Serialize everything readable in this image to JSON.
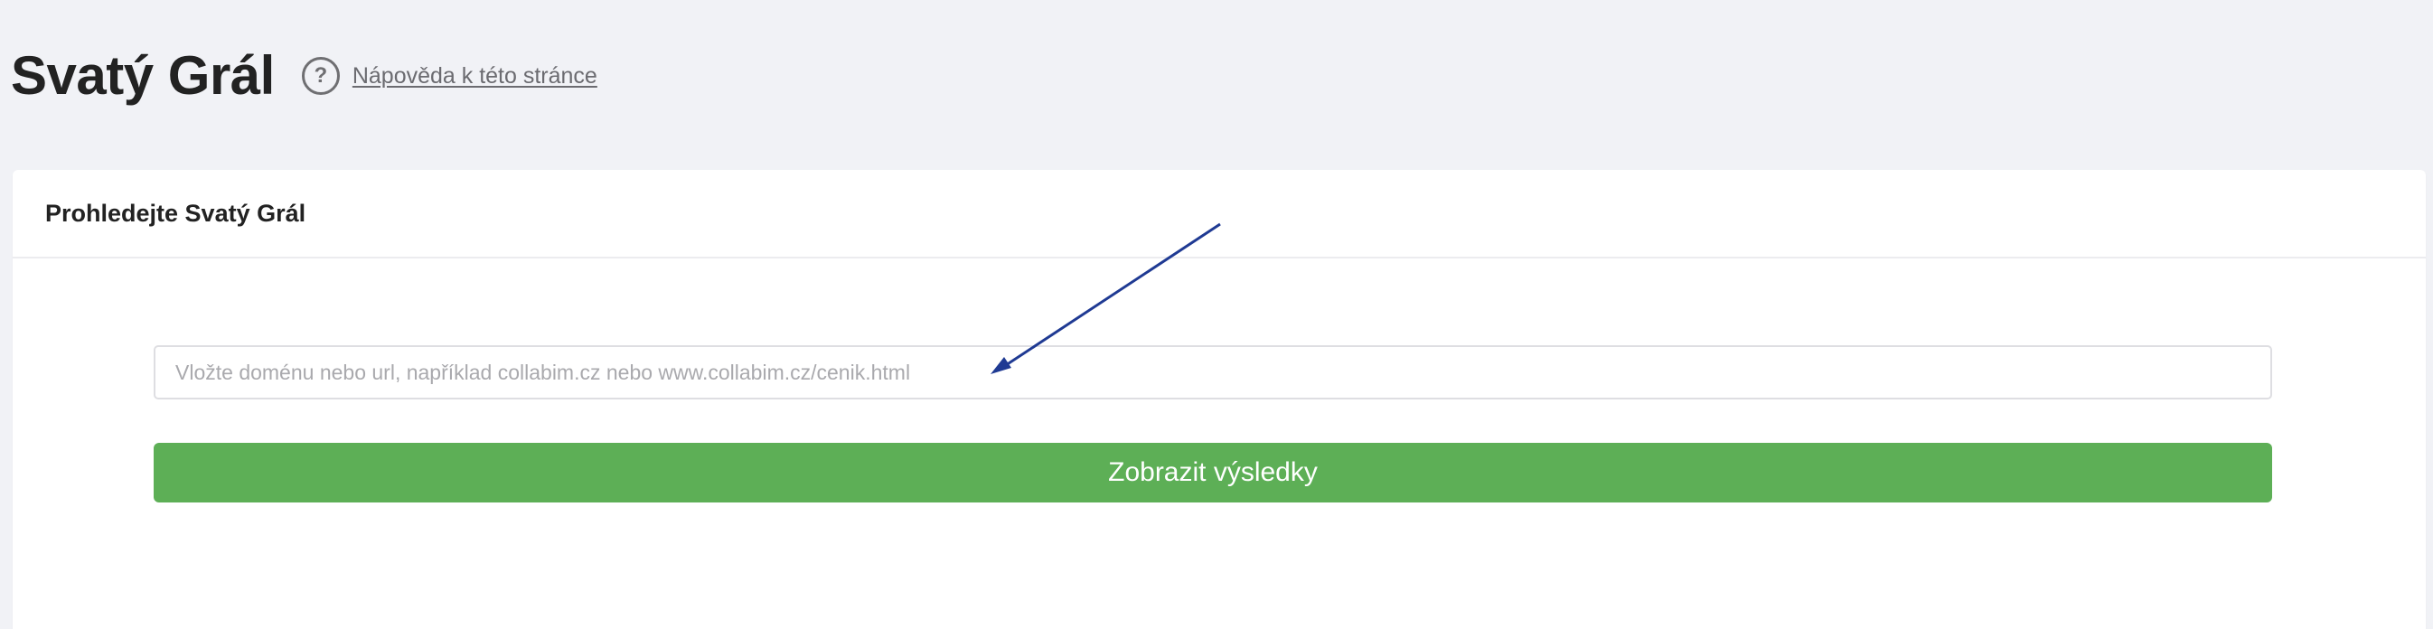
{
  "header": {
    "title": "Svatý Grál",
    "help_icon_symbol": "?",
    "help_link": "Nápověda k této stránce"
  },
  "card": {
    "title": "Prohledejte Svatý Grál"
  },
  "search": {
    "value": "",
    "placeholder": "Vložte doménu nebo url, například collabim.cz nebo www.collabim.cz/cenik.html"
  },
  "submit": {
    "label": "Zobrazit výsledky"
  },
  "colors": {
    "background": "#f1f2f6",
    "button": "#5daf56",
    "annotation_arrow": "#1f3a93"
  },
  "icons": {
    "help": "question-circle-icon",
    "annotation": "arrow-annotation"
  }
}
